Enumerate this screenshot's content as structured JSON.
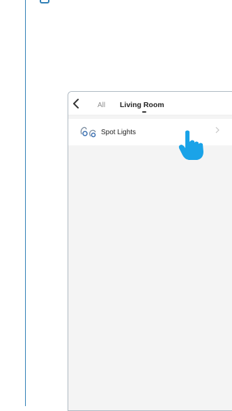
{
  "header": {
    "tabs": [
      {
        "label": "All",
        "active": false
      },
      {
        "label": "Living Room",
        "active": true
      }
    ]
  },
  "devices": [
    {
      "label": "Spot Lights",
      "icon": "spot-lights-icon"
    }
  ],
  "colors": {
    "accent": "#1aa3e8",
    "frame": "#2f7fb5",
    "list_bg": "#f4f4f4"
  },
  "icons": {
    "back": "chevron-left-icon",
    "row": "chevron-right-icon",
    "pointer": "hand-pointer-icon"
  }
}
